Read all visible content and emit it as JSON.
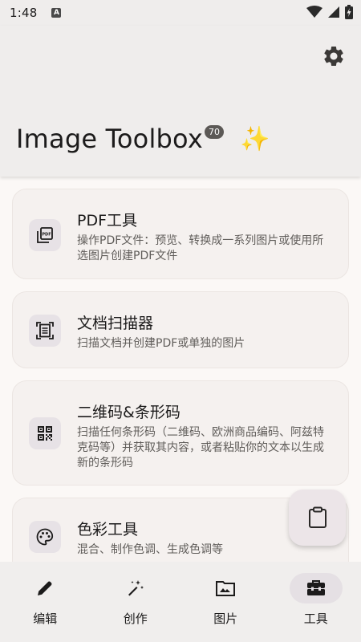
{
  "status_bar": {
    "time": "1:48",
    "indicator": "A"
  },
  "header": {
    "title": "Image Toolbox",
    "badge": "70",
    "sparkles_icon": "sparkles-icon",
    "settings_icon": "gear-icon"
  },
  "cards": [
    {
      "title": "PDF工具",
      "description": "操作PDF文件：预览、转换成一系列图片或使用所选图片创建PDF文件",
      "icon": "pdf-icon"
    },
    {
      "title": "文档扫描器",
      "description": "扫描文档并创建PDF或单独的图片",
      "icon": "document-scanner-icon"
    },
    {
      "title": "二维码&条形码",
      "description": "扫描任何条形码（二维码、欧洲商品编码、阿兹特克码等）并获取其内容，或者粘贴你的文本以生成新的条形码",
      "icon": "qr-code-icon"
    },
    {
      "title": "色彩工具",
      "description": "混合、制作色调、生成色调等",
      "icon": "palette-icon"
    }
  ],
  "fab": {
    "icon": "clipboard-icon"
  },
  "bottom_nav": [
    {
      "label": "编辑",
      "icon": "pencil-icon",
      "active": false
    },
    {
      "label": "创作",
      "icon": "magic-wand-icon",
      "active": false
    },
    {
      "label": "图片",
      "icon": "image-folder-icon",
      "active": false
    },
    {
      "label": "工具",
      "icon": "toolbox-icon",
      "active": true
    }
  ],
  "colors": {
    "background": "#fbf8f6",
    "header": "#efedec",
    "card": "#f5f1ef",
    "icon_container": "#e7e2e6",
    "active_nav_pill": "#e5e0e4",
    "sparkles": "#f4c22e"
  }
}
